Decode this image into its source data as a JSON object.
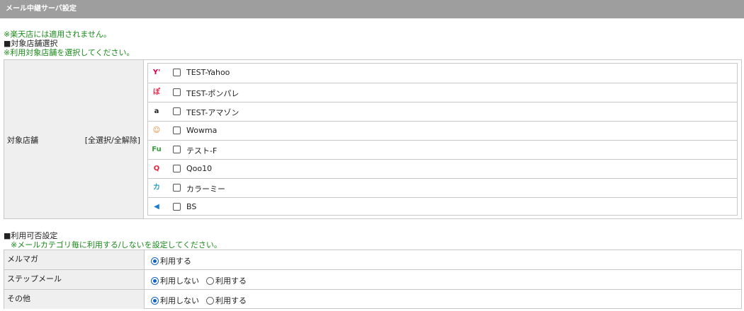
{
  "header": {
    "title": "メール中継サーバ設定"
  },
  "notes": {
    "rakuten": "※楽天店には適用されません。",
    "target_heading": "■対象店舗選択",
    "target_hint": "※利用対象店舗を選択してください。"
  },
  "stores": {
    "label": "対象店舗",
    "select_all": "[全選択/全解除]",
    "items": [
      {
        "name": "TEST-Yahoo",
        "icon": "yahoo-icon",
        "color": "#e0004a"
      },
      {
        "name": "TEST-ポンパレ",
        "icon": "ponpare-icon",
        "color": "#e8294a"
      },
      {
        "name": "TEST-アマゾン",
        "icon": "amazon-icon",
        "color": "#222222"
      },
      {
        "name": "Wowma",
        "icon": "wowma-icon",
        "color": "#f07a2a"
      },
      {
        "name": "テスト-F",
        "icon": "fu-icon",
        "color": "#3aa040"
      },
      {
        "name": "Qoo10",
        "icon": "qoo10-icon",
        "color": "#e8203a"
      },
      {
        "name": "カラーミー",
        "icon": "colorme-icon",
        "color": "#26a0d0"
      },
      {
        "name": "BS",
        "icon": "megaphone-icon",
        "color": "#1a7fd0"
      }
    ]
  },
  "usage": {
    "heading": "■利用可否設定",
    "hint": "※メールカテゴリ毎に利用する/しないを設定してください。",
    "rows": [
      {
        "label": "メルマガ",
        "options": [
          {
            "label": "利用する",
            "selected": true
          }
        ]
      },
      {
        "label": "ステップメール",
        "options": [
          {
            "label": "利用しない",
            "selected": true
          },
          {
            "label": "利用する",
            "selected": false
          }
        ]
      },
      {
        "label": "その他",
        "options": [
          {
            "label": "利用しない",
            "selected": true
          },
          {
            "label": "利用する",
            "selected": false
          }
        ]
      }
    ]
  }
}
